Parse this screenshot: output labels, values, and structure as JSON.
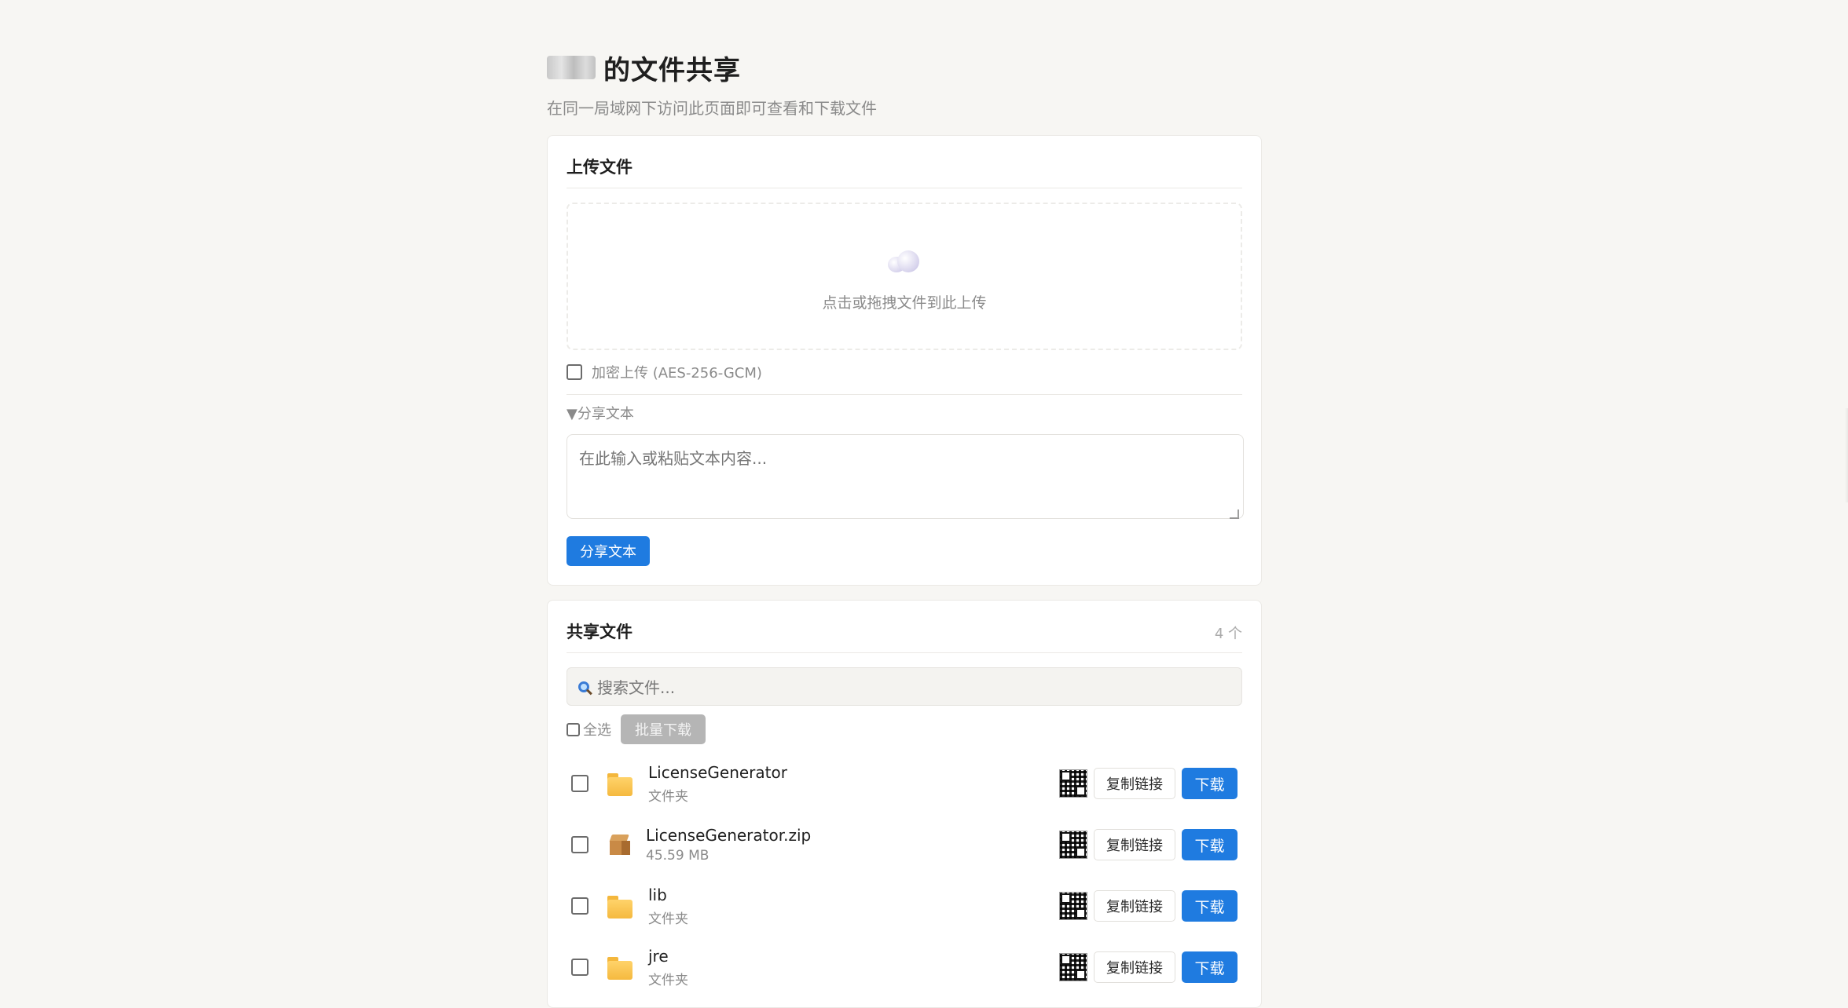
{
  "header": {
    "title": "的文件共享",
    "subtitle": "在同一局域网下访问此页面即可查看和下载文件"
  },
  "upload": {
    "title": "上传文件",
    "dropzone_text": "点击或拖拽文件到此上传",
    "encrypt_label": "加密上传 (AES-256-GCM)",
    "encrypt_checked": false,
    "share_text_toggle": "▼分享文本",
    "textarea_placeholder": "在此输入或粘贴文本内容...",
    "share_button": "分享文本"
  },
  "files": {
    "title": "共享文件",
    "count": "4 个",
    "search_placeholder": "搜索文件...",
    "select_all_label": "全选",
    "batch_download": "批量下载",
    "copy_link_label": "复制链接",
    "download_label": "下载",
    "items": [
      {
        "name": "LicenseGenerator",
        "meta": "文件夹",
        "icon": "folder-icon"
      },
      {
        "name": "LicenseGenerator.zip",
        "meta": "45.59 MB",
        "icon": "package-icon"
      },
      {
        "name": "lib",
        "meta": "文件夹",
        "icon": "folder-icon"
      },
      {
        "name": "jre",
        "meta": "文件夹",
        "icon": "folder-icon"
      }
    ]
  },
  "colors": {
    "accent": "#1f7be0",
    "background": "#f7f6f3",
    "disabled": "#b5b5b5"
  }
}
